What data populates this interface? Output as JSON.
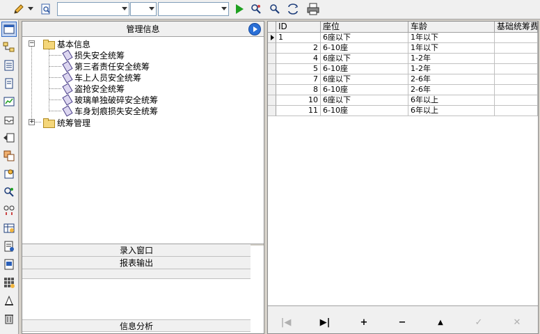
{
  "toolbar": {
    "combo1_value": "",
    "combo2_value": "",
    "combo3_value": ""
  },
  "mgmt_panel": {
    "title": "管理信息",
    "tree": [
      {
        "label": "基本信息",
        "type": "folder",
        "expanded": true,
        "children": [
          "损失安全统筹",
          "第三者责任安全统筹",
          "车上人员安全统筹",
          "盗抢安全统筹",
          "玻璃单独破碎安全统筹",
          "车身划痕损失安全统筹"
        ]
      },
      {
        "label": "统筹管理",
        "type": "folder",
        "expanded": false,
        "children": []
      }
    ],
    "sections": {
      "entry_window": "录入窗口",
      "report_output": "报表输出",
      "info_analysis": "信息分析"
    }
  },
  "grid": {
    "columns": [
      "ID",
      "座位",
      "车龄",
      "基础统筹费"
    ],
    "rows": [
      {
        "id": "1",
        "seats": "6座以下",
        "age": "1年以下",
        "fee": "",
        "current": true
      },
      {
        "id": "2",
        "seats": "6-10座",
        "age": "1年以下",
        "fee": ""
      },
      {
        "id": "4",
        "seats": "6座以下",
        "age": "1-2年",
        "fee": ""
      },
      {
        "id": "5",
        "seats": "6-10座",
        "age": "1-2年",
        "fee": ""
      },
      {
        "id": "7",
        "seats": "6座以下",
        "age": "2-6年",
        "fee": ""
      },
      {
        "id": "8",
        "seats": "6-10座",
        "age": "2-6年",
        "fee": ""
      },
      {
        "id": "10",
        "seats": "6座以下",
        "age": "6年以上",
        "fee": ""
      },
      {
        "id": "11",
        "seats": "6-10座",
        "age": "6年以上",
        "fee": ""
      }
    ],
    "navigator": {
      "first": "|◀",
      "last": "▶|",
      "insert": "+",
      "delete": "−",
      "edit": "▲",
      "post": "✓",
      "cancel": "✕"
    }
  },
  "colors": {
    "accent": "#316ac5",
    "panel_bg": "#f0f0f0",
    "window_bg": "#d4d0c8"
  }
}
